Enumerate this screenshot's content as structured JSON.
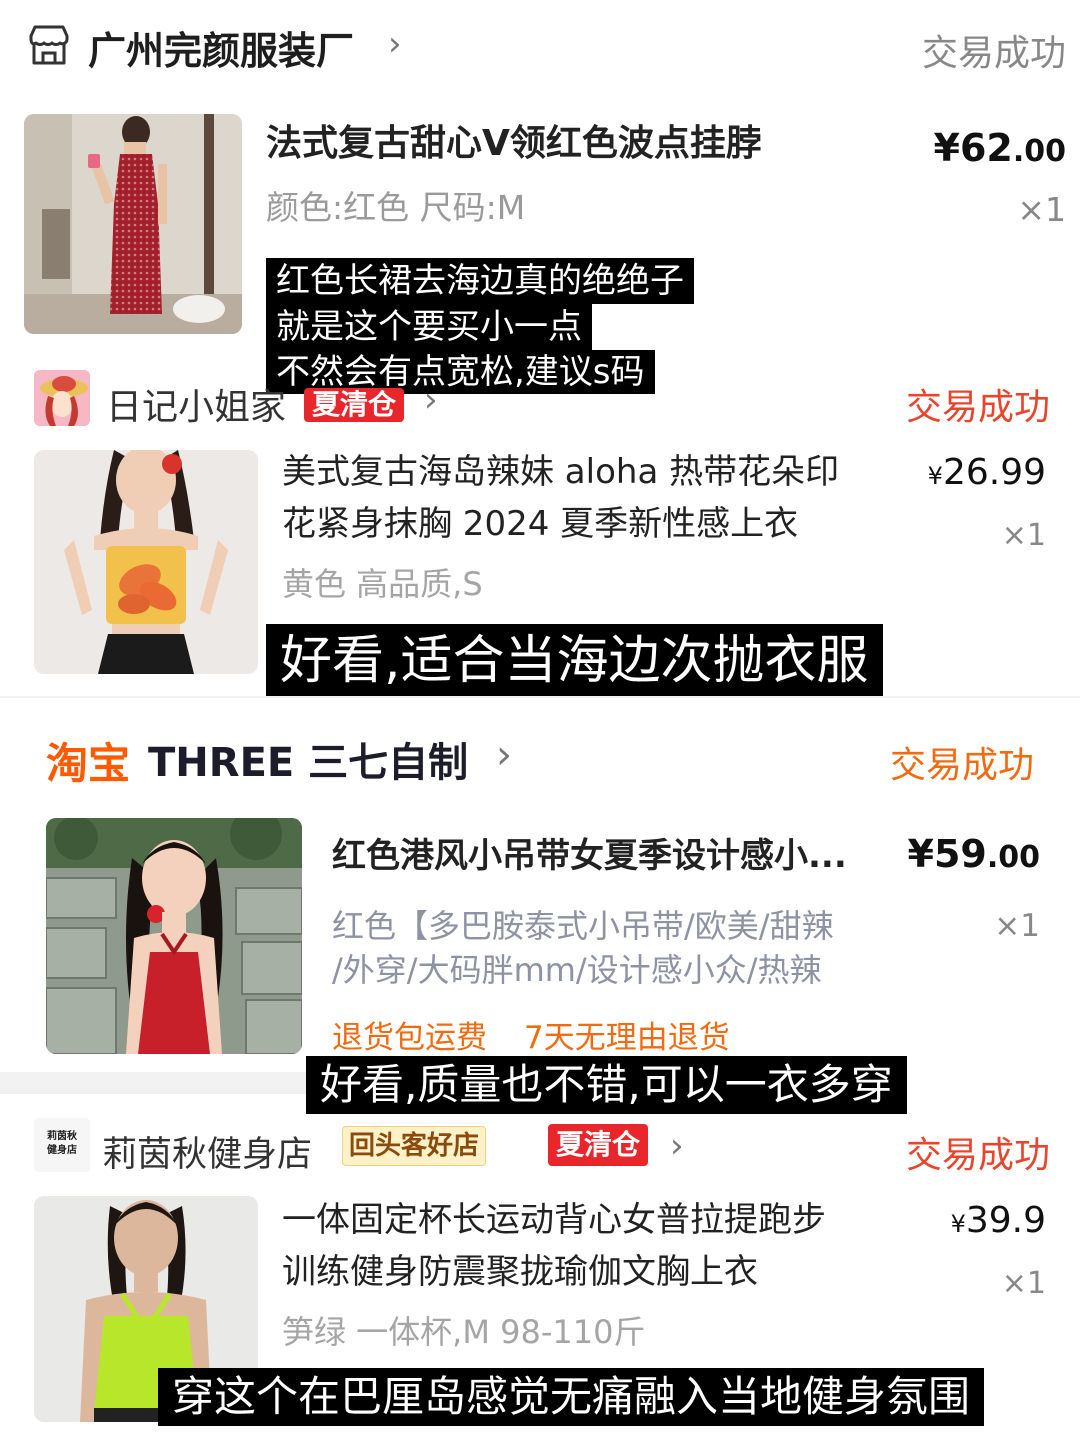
{
  "colors": {
    "status_grey": "#888888",
    "status_red": "#e8452d",
    "status_orange": "#f36b10",
    "badge_red": "#e8262c",
    "caption_bg": "#000000"
  },
  "orders": [
    {
      "shop_icon": "store-icon",
      "shop_name": "广州完颜服装厂",
      "status": "交易成功",
      "title": "法式复古甜心V领红色波点挂脖",
      "spec": "颜色:红色 尺码:M",
      "price_int": "¥62",
      "price_dec": ".00",
      "qty": "×1",
      "caption_lines": [
        "红色长裙去海边真的绝绝子",
        "就是这个要买小一点",
        "不然会有点宽松,建议s码"
      ]
    },
    {
      "shop_avatar": "avatar-cartoon",
      "shop_name": "日记小姐家",
      "badge": "夏清仓",
      "status": "交易成功",
      "title_lines": [
        "美式复古海岛辣妹 aloha 热带花朵印",
        "花紧身抹胸 2024 夏季新性感上衣"
      ],
      "spec": "黄色 高品质,S",
      "price_sym": "¥",
      "price_int": "26.99",
      "qty": "×1",
      "caption": "好看,适合当海边次抛衣服"
    },
    {
      "platform": "淘宝",
      "shop_name": "THREE 三七自制",
      "status": "交易成功",
      "title": "红色港风小吊带女夏季设计感小...",
      "spec_lines": [
        "红色【多巴胺泰式小吊带/欧美/甜辣",
        "/外穿/大码胖mm/设计感小众/热辣"
      ],
      "services": [
        "退货包运费",
        "7天无理由退货"
      ],
      "price_int": "¥59",
      "price_dec": ".00",
      "qty": "×1",
      "caption": "好看,质量也不错,可以一衣多穿"
    },
    {
      "shop_logo_lines": [
        "莉茵秋",
        "健身店"
      ],
      "shop_name": "莉茵秋健身店",
      "badge_repeat": "回头客好店",
      "badge": "夏清仓",
      "status": "交易成功",
      "title_lines": [
        "一体固定杯长运动背心女普拉提跑步",
        "训练健身防震聚拢瑜伽文胸上衣"
      ],
      "spec": "笋绿 一体杯,M 98-110斤",
      "price_sym": "¥",
      "price_int": "39.9",
      "qty": "×1",
      "caption": "穿这个在巴厘岛感觉无痛融入当地健身氛围"
    }
  ]
}
